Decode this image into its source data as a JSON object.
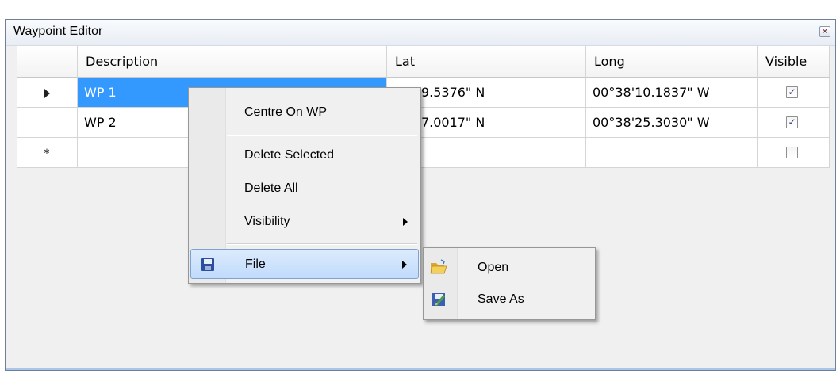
{
  "window": {
    "title": "Waypoint Editor",
    "close_icon": "close-icon"
  },
  "grid": {
    "headers": [
      "Description",
      "Lat",
      "Long",
      "Visible"
    ],
    "rows": [
      {
        "marker": "current",
        "description": "WP 1",
        "lat": "38'29.5376\" N",
        "long": "00°38'10.1837\" W",
        "visible": true
      },
      {
        "marker": "",
        "description": "WP 2",
        "lat": "38'37.0017\" N",
        "long": "00°38'25.3030\" W",
        "visible": true
      },
      {
        "marker": "new",
        "new_row_glyph": "*",
        "description": "",
        "lat": "",
        "long": "",
        "visible": false
      }
    ]
  },
  "context_menu": {
    "items": [
      {
        "label": "Centre On WP"
      },
      {
        "label": "Delete Selected"
      },
      {
        "label": "Delete All"
      },
      {
        "label": "Visibility",
        "submenu": true
      },
      {
        "label": "File",
        "submenu": true,
        "icon": "floppy-disk-icon",
        "highlighted": true
      }
    ]
  },
  "file_submenu": {
    "items": [
      {
        "label": "Open",
        "icon": "folder-open-icon"
      },
      {
        "label": "Save As",
        "icon": "save-as-icon"
      }
    ]
  },
  "colors": {
    "selection": "#3399ff",
    "menu_highlight": "#c1dbfc",
    "window_border": "#6e7f97"
  }
}
